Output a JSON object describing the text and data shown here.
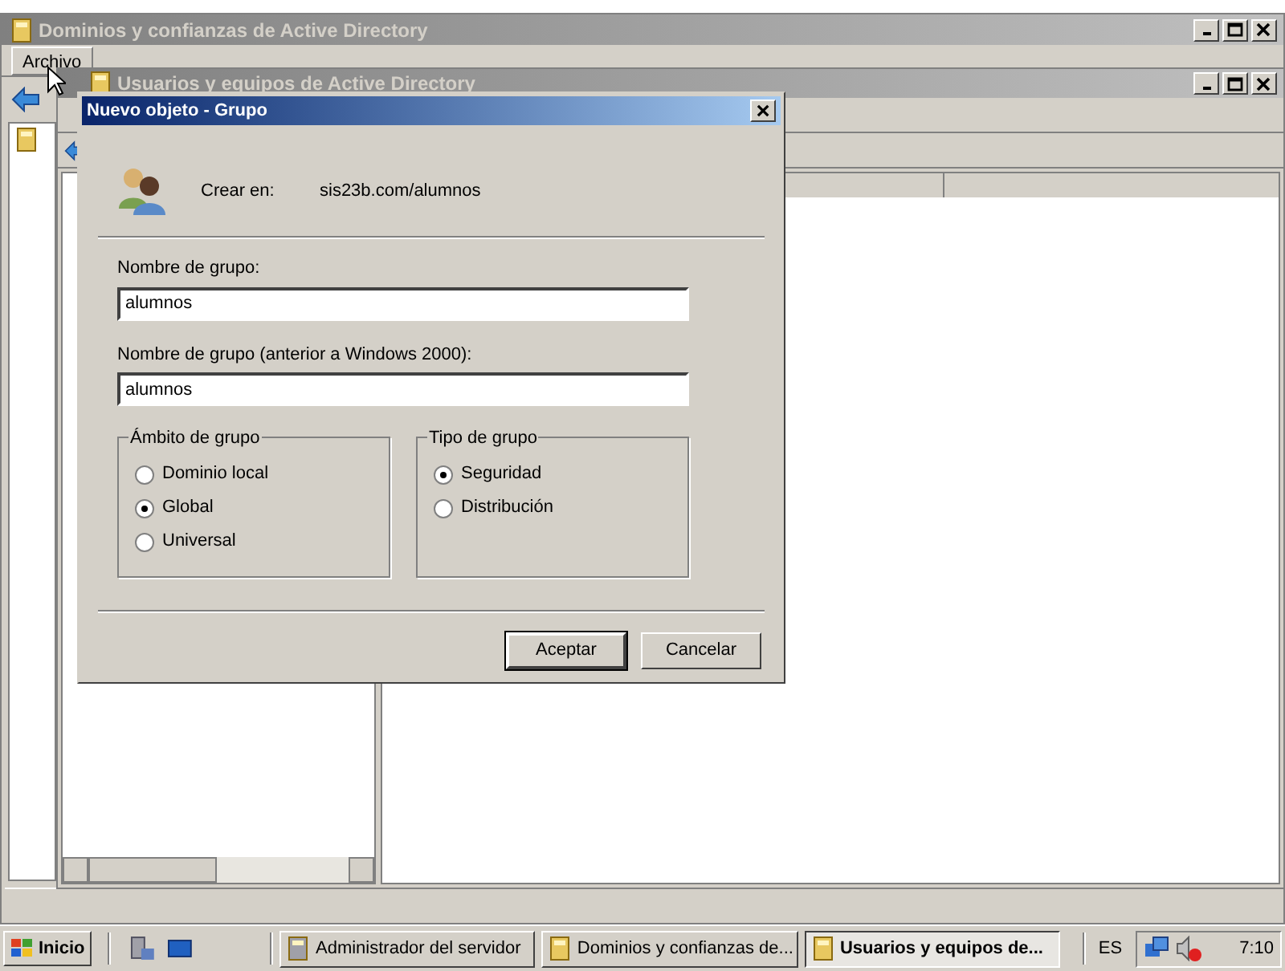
{
  "background_window": {
    "title": "Dominios y confianzas de Active Directory",
    "menu": [
      "Archivo"
    ]
  },
  "main_window": {
    "title": "Usuarios y equipos de Active Directory"
  },
  "dialog": {
    "title": "Nuevo objeto - Grupo",
    "create_in_label": "Crear en:",
    "create_in_value": "sis23b.com/alumnos",
    "fields": [
      {
        "label": "Nombre de grupo:",
        "value": "alumnos"
      },
      {
        "label": "Nombre de grupo (anterior a Windows 2000):",
        "value": "alumnos"
      }
    ],
    "groups": [
      {
        "title": "Ámbito de grupo",
        "options": [
          {
            "label": "Dominio local",
            "selected": false
          },
          {
            "label": "Global",
            "selected": true
          },
          {
            "label": "Universal",
            "selected": false
          }
        ]
      },
      {
        "title": "Tipo de grupo",
        "options": [
          {
            "label": "Seguridad",
            "selected": true
          },
          {
            "label": "Distribución",
            "selected": false
          }
        ]
      }
    ],
    "buttons": [
      {
        "label": "Aceptar",
        "default": true
      },
      {
        "label": "Cancelar",
        "default": false
      }
    ]
  },
  "taskbar": {
    "start": "Inicio",
    "tasks": [
      {
        "label": "Administrador del servidor",
        "selected": false
      },
      {
        "label": "Dominios y confianzas de...",
        "selected": false
      },
      {
        "label": "Usuarios y equipos de...",
        "selected": true
      }
    ],
    "language": "ES",
    "clock": "7:10"
  }
}
